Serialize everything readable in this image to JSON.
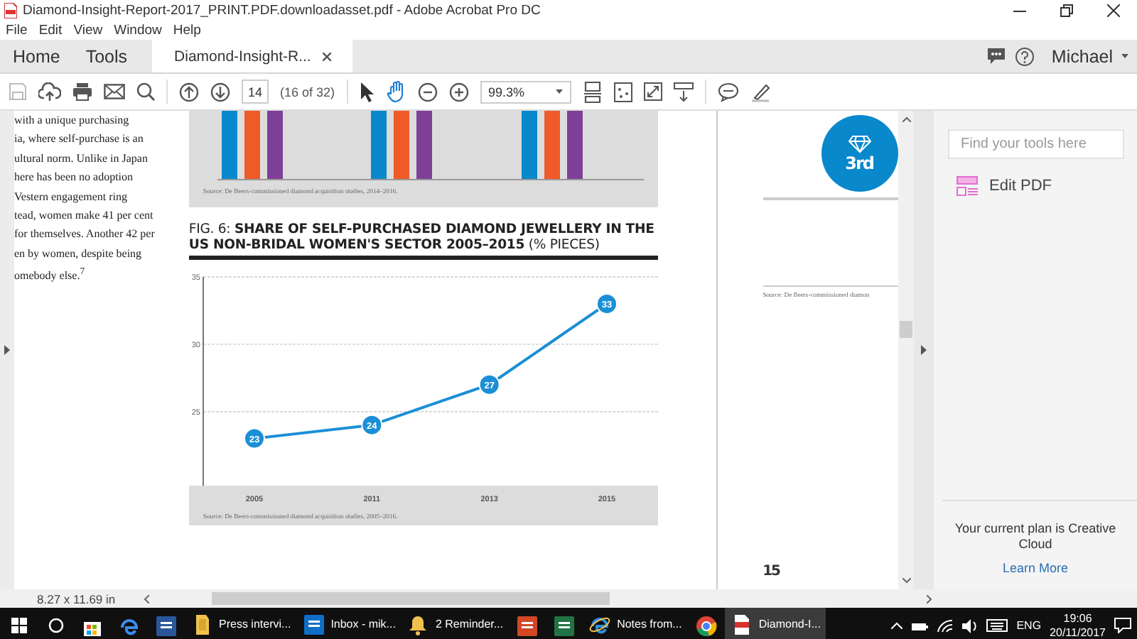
{
  "window": {
    "title": "Diamond-Insight-Report-2017_PRINT.PDF.downloadasset.pdf - Adobe Acrobat Pro DC"
  },
  "menu": [
    "File",
    "Edit",
    "View",
    "Window",
    "Help"
  ],
  "tabs": [
    {
      "label": "Home",
      "selected": false,
      "kind": "nav"
    },
    {
      "label": "Tools",
      "selected": false,
      "kind": "nav"
    },
    {
      "label": "Diamond-Insight-R...",
      "selected": true,
      "kind": "document"
    }
  ],
  "account": {
    "user": "Michael"
  },
  "toolbar": {
    "page": "14",
    "page_count": "(16 of 32)",
    "zoom": "99.3%"
  },
  "document": {
    "paragraph_lines": [
      "with a unique purchasing",
      "ia, where self-purchase is an",
      "ultural norm. Unlike in Japan",
      "here has been no adoption",
      "Vestern engagement ring",
      "tead, women make 41 per cent",
      "for themselves. Another 42 per",
      "en by women, despite being",
      "omebody else.$^{7}$"
    ],
    "bar_caption": "Source: De Beers-commissioned diamond acquisition studies, 2014–2016.",
    "figure_title": "FIG. 6: **SHARE OF SELF-PURCHASED DIAMOND JEWELLERY IN THE US NON-BRIDAL WOMEN'S SECTOR 2005–2015** (% PIECES)",
    "chart_data": {
      "type": "line",
      "categories": [
        "2005",
        "2011",
        "2013",
        "2015"
      ],
      "series": [
        {
          "color": "#1a8fd6",
          "marker": "circle",
          "values": [
            23,
            24,
            27,
            33
          ]
        }
      ],
      "ylim": [
        19.5,
        35
      ],
      "yticks": [
        25,
        30,
        35
      ],
      "data_labels": true
    },
    "chart_source": "Source: De Beers-commissioned diamond acquisition studies, 2005–2016.",
    "badge": "3rd",
    "right_source": "Source: De Beers-commissioned diamon",
    "page_number": "15"
  },
  "tools_pane": {
    "search": {
      "placeholder": "Find your tools here"
    },
    "items": [
      "Edit PDF"
    ],
    "plan": "Your current plan is Creative Cloud",
    "link": "Learn More"
  },
  "status_bar": {
    "page_size": "8.27 x 11.69 in"
  },
  "taskbar": {
    "apps": [
      {
        "kind": "store",
        "selected": false,
        "running": false
      },
      {
        "kind": "edge",
        "selected": false,
        "running": false
      },
      {
        "kind": "word",
        "selected": false,
        "running": false
      },
      {
        "kind": "folder",
        "label": "Press intervi...",
        "selected": false,
        "running": true
      },
      {
        "kind": "outlook",
        "label": "Inbox - mik...",
        "selected": false,
        "running": true
      },
      {
        "kind": "bell",
        "label": "2 Reminder...",
        "selected": false,
        "running": true
      },
      {
        "kind": "powerpoint",
        "selected": false,
        "running": false
      },
      {
        "kind": "excel",
        "selected": false,
        "running": false
      },
      {
        "kind": "ie",
        "label": "Notes from...",
        "selected": false,
        "running": true
      },
      {
        "kind": "chrome",
        "selected": false,
        "running": false
      },
      {
        "kind": "acrobat",
        "label": "Diamond-I...",
        "selected": true,
        "running": true
      }
    ],
    "tray": {
      "language": "ENG",
      "time": "19:06",
      "date": "20/11/2017"
    }
  }
}
